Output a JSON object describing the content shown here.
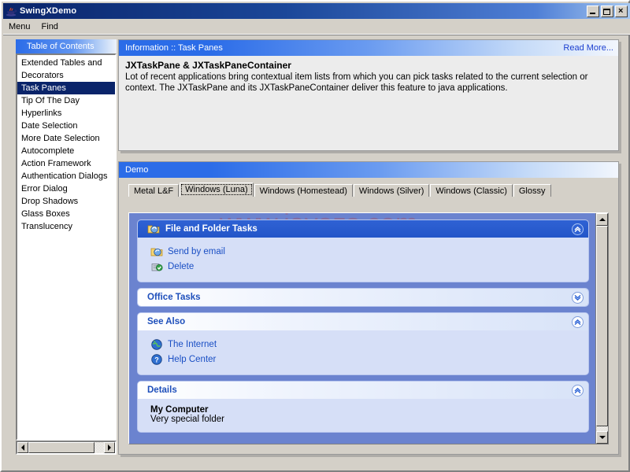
{
  "window": {
    "title": "SwingXDemo",
    "icon": "java-cup-icon",
    "buttons": {
      "minimize": "Minimize",
      "maximize": "Maximize",
      "close": "Close"
    }
  },
  "menubar": {
    "items": [
      {
        "label": "Menu"
      },
      {
        "label": "Find"
      }
    ]
  },
  "toc": {
    "header": "Table of Contents",
    "items": [
      {
        "label": "Extended Tables and",
        "selected": false
      },
      {
        "label": "Decorators",
        "selected": false
      },
      {
        "label": "Task Panes",
        "selected": true
      },
      {
        "label": "Tip Of The Day",
        "selected": false
      },
      {
        "label": "Hyperlinks",
        "selected": false
      },
      {
        "label": "Date Selection",
        "selected": false
      },
      {
        "label": "More Date Selection",
        "selected": false
      },
      {
        "label": "Autocomplete",
        "selected": false
      },
      {
        "label": "Action Framework",
        "selected": false
      },
      {
        "label": "Authentication Dialogs",
        "selected": false
      },
      {
        "label": "Error Dialog",
        "selected": false
      },
      {
        "label": "Drop Shadows",
        "selected": false
      },
      {
        "label": "Glass Boxes",
        "selected": false
      },
      {
        "label": "Translucency",
        "selected": false
      }
    ]
  },
  "info": {
    "header": "Information :: Task Panes",
    "read_more": "Read More...",
    "heading": "JXTaskPane & JXTaskPaneContainer",
    "paragraph": "Lot of recent applications bring contextual item lists from which you can pick tasks related to the current selection or context. The JXTaskPane and its JXTaskPaneContainer deliver this feature to java applications."
  },
  "demo": {
    "header": "Demo",
    "tabs": [
      {
        "label": "Metal L&F",
        "active": false
      },
      {
        "label": "Windows (Luna)",
        "active": true
      },
      {
        "label": "Windows (Homestead)",
        "active": false
      },
      {
        "label": "Windows (Silver)",
        "active": false
      },
      {
        "label": "Windows (Classic)",
        "active": false
      },
      {
        "label": "Glossy",
        "active": false
      }
    ],
    "watermark": "www.javazs.com",
    "taskpanes": [
      {
        "title": "File and Folder Tasks",
        "style": "special",
        "icon": "folder-tasks-icon",
        "expanded": true,
        "toggle": "chevron-double-up-icon",
        "links": [
          {
            "label": "Send by email",
            "icon": "send-email-icon"
          },
          {
            "label": "Delete",
            "icon": "delete-icon"
          }
        ]
      },
      {
        "title": "Office Tasks",
        "style": "normal",
        "expanded": false,
        "toggle": "chevron-double-down-icon",
        "links": []
      },
      {
        "title": "See Also",
        "style": "normal",
        "expanded": true,
        "toggle": "chevron-double-up-icon",
        "links": [
          {
            "label": "The Internet",
            "icon": "globe-icon"
          },
          {
            "label": "Help Center",
            "icon": "help-icon"
          }
        ]
      },
      {
        "title": "Details",
        "style": "normal",
        "expanded": true,
        "toggle": "chevron-double-up-icon",
        "detail_title": "My Computer",
        "detail_subtitle": "Very special folder",
        "links": []
      }
    ]
  },
  "colors": {
    "titlebar_start": "#0a246a",
    "panel_header_blue": "#2b6ce8",
    "selection": "#0a246a",
    "taskpane_container_bg": "#6b83cf",
    "taskpane_body_bg": "#d6dff7",
    "link": "#1a4fc4",
    "face": "#d4d0c8"
  }
}
